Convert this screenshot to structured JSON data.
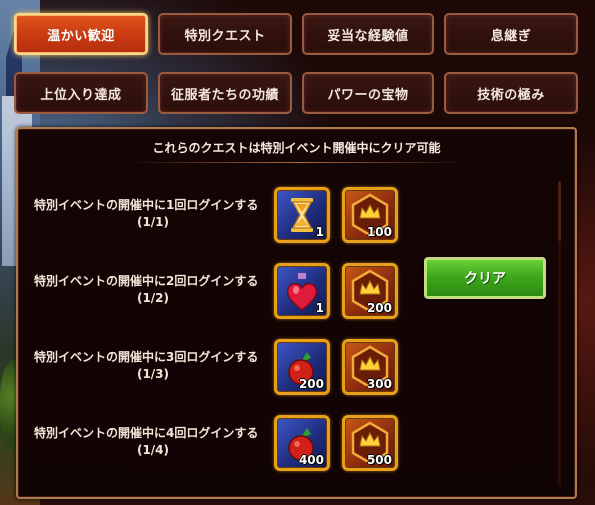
{
  "tabs_row1": [
    {
      "label": "温かい歓迎",
      "active": true
    },
    {
      "label": "特別クエスト",
      "active": false
    },
    {
      "label": "妥当な経験値",
      "active": false
    },
    {
      "label": "息継ぎ",
      "active": false
    }
  ],
  "tabs_row2": [
    {
      "label": "上位入り達成",
      "active": false
    },
    {
      "label": "征服者たちの功績",
      "active": false
    },
    {
      "label": "パワーの宝物",
      "active": false
    },
    {
      "label": "技術の極み",
      "active": false
    }
  ],
  "panel": {
    "title": "これらのクエストは特別イベント開催中にクリア可能"
  },
  "quests": [
    {
      "label": "特別イベントの開催中に1回ログインする",
      "progress": "(1/1)",
      "rewards": [
        {
          "icon": "hourglass-icon",
          "qty": "1"
        },
        {
          "icon": "crown-hexagon-icon",
          "qty": "100"
        }
      ],
      "claim_label": "クリア"
    },
    {
      "label": "特別イベントの開催中に2回ログインする",
      "progress": "(1/2)",
      "rewards": [
        {
          "icon": "heart-potion-icon",
          "qty": "1"
        },
        {
          "icon": "crown-hexagon-icon",
          "qty": "200"
        }
      ]
    },
    {
      "label": "特別イベントの開催中に3回ログインする",
      "progress": "(1/3)",
      "rewards": [
        {
          "icon": "berry-icon",
          "qty": "200"
        },
        {
          "icon": "crown-hexagon-icon",
          "qty": "300"
        }
      ]
    },
    {
      "label": "特別イベントの開催中に4回ログインする",
      "progress": "(1/4)",
      "rewards": [
        {
          "icon": "berry-icon",
          "qty": "400"
        },
        {
          "icon": "crown-hexagon-icon",
          "qty": "500"
        }
      ]
    }
  ],
  "colors": {
    "active_tab": "#d44818",
    "claim_button": "#3ea81c",
    "reward_border": "#e8a018"
  }
}
